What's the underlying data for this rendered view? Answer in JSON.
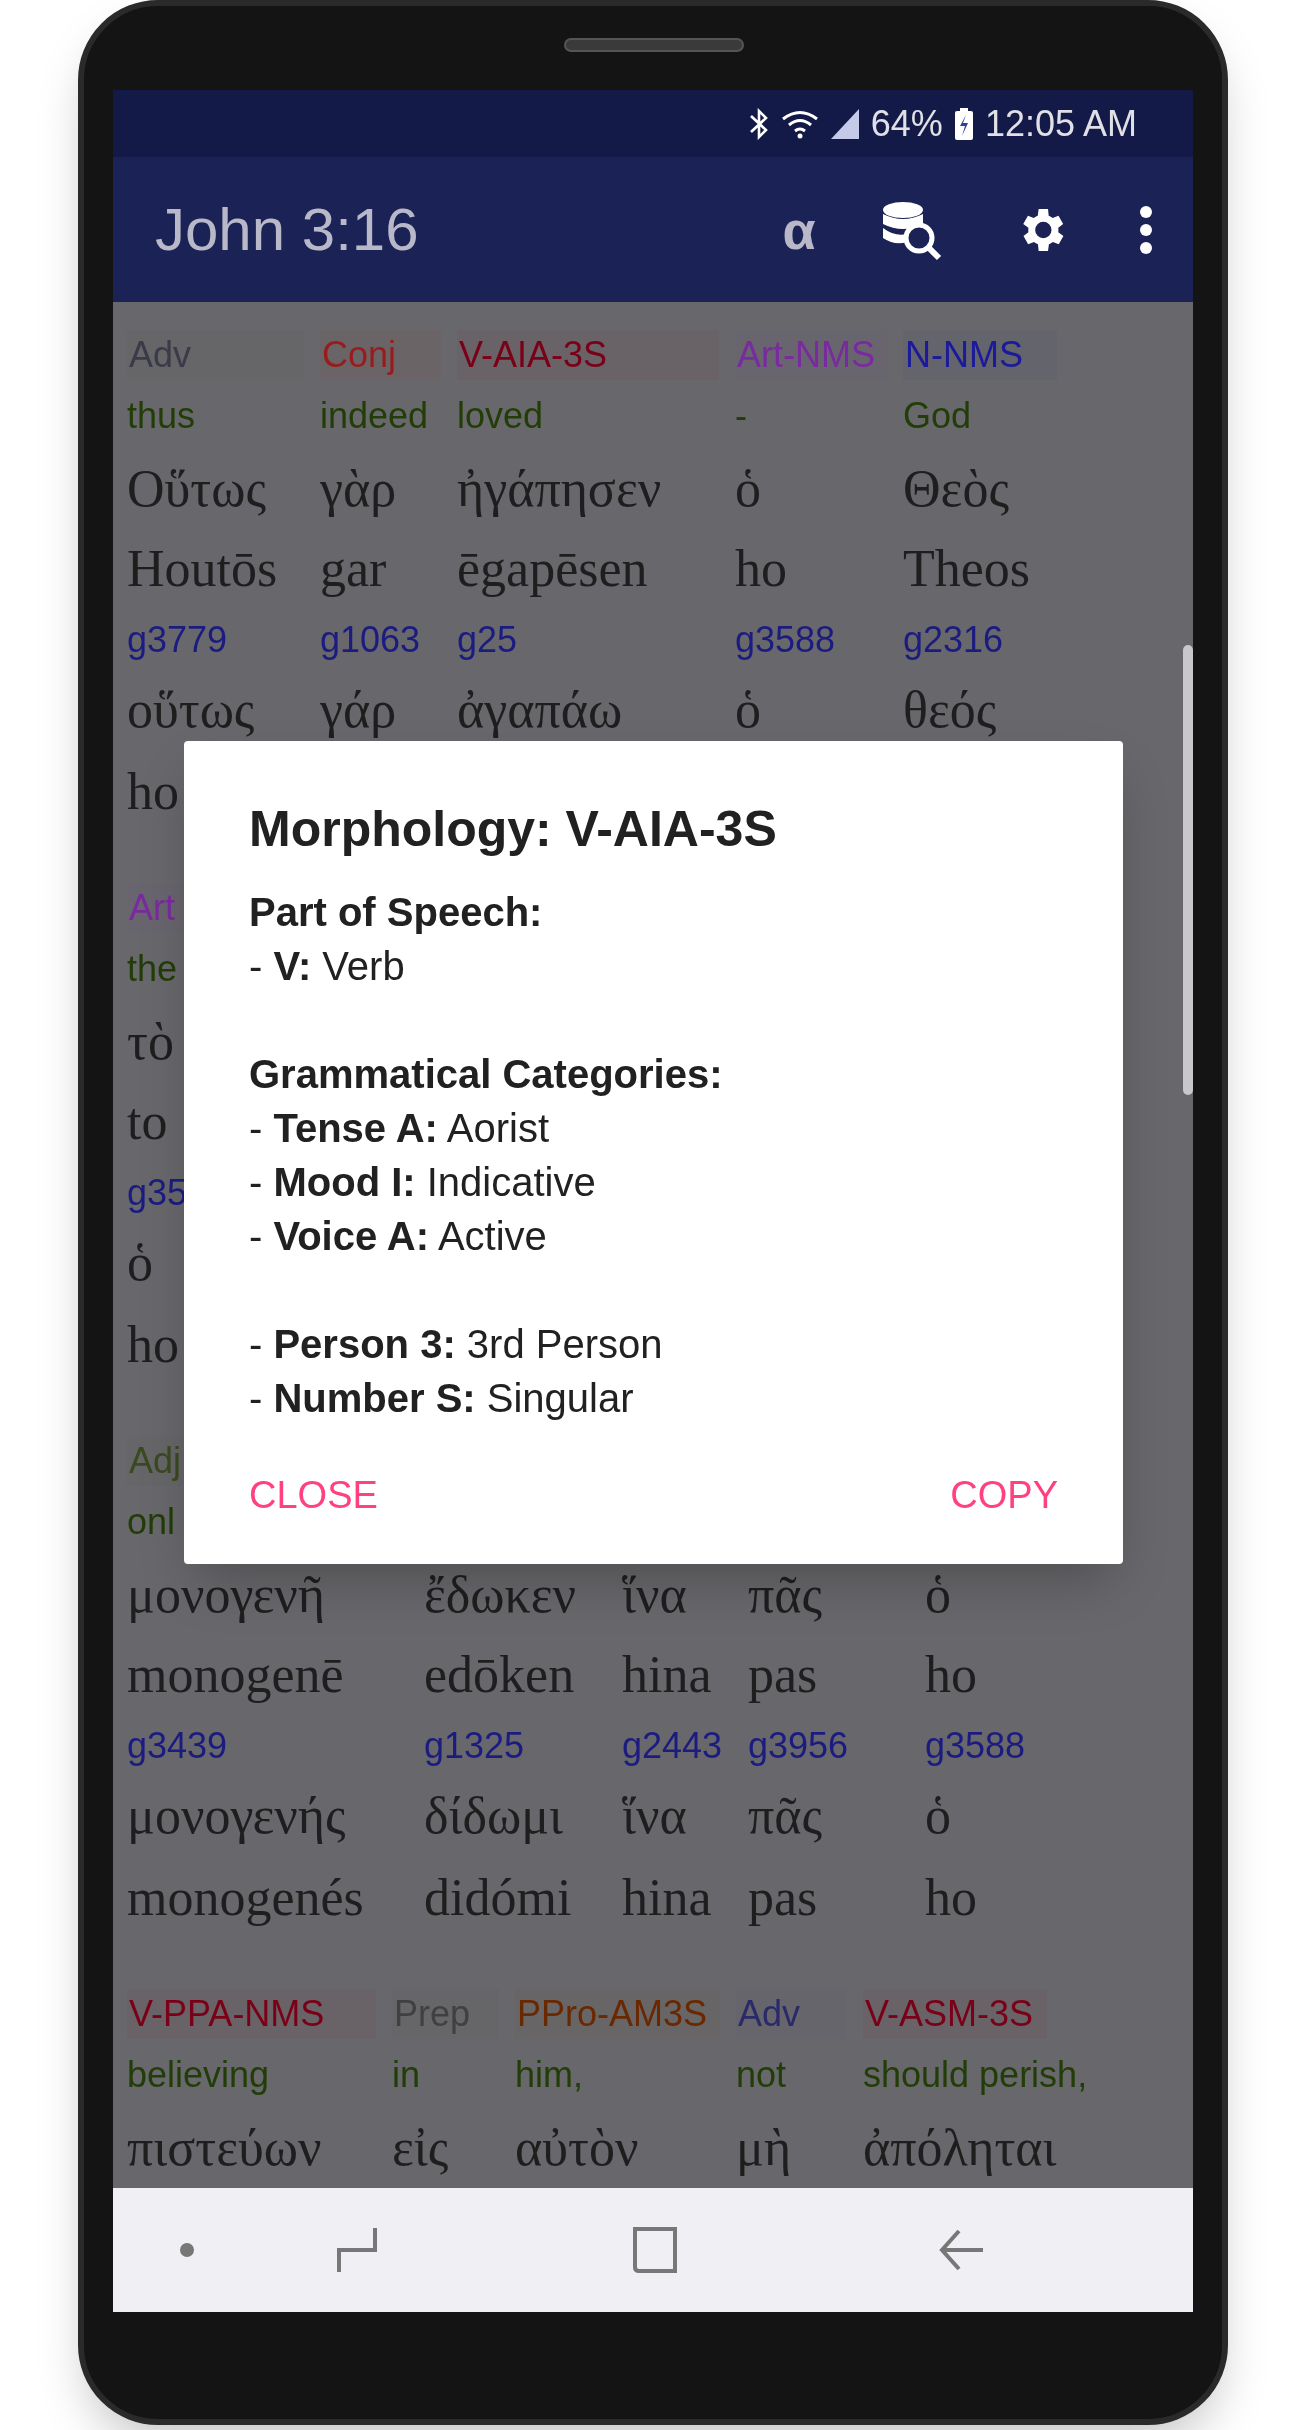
{
  "status_bar": {
    "battery_text": "64%",
    "time": "12:05 AM"
  },
  "app_bar": {
    "title": "John 3:16",
    "alpha_button": "α"
  },
  "blocks": [
    {
      "columns": [
        {
          "tag": "Adv",
          "color": "#3a3a48",
          "gloss": "thus",
          "greek": "Οὕτως",
          "translit": "Houtōs",
          "strong": "g3779",
          "lemma": "οὕτως",
          "lemma_translit": "ho"
        },
        {
          "tag": "Conj",
          "color": "#9a1b1b",
          "gloss": "indeed",
          "greek": "γὰρ",
          "translit": "gar",
          "strong": "g1063",
          "lemma": "γάρ"
        },
        {
          "tag": "V-AIA-3S",
          "color": "#7a0018",
          "gloss": "loved",
          "greek": "ἠγάπησεν",
          "translit": "ēgapēsen",
          "strong": "g25",
          "lemma": "ἀγαπάω"
        },
        {
          "tag": "Art-NMS",
          "color": "#7a2aa0",
          "gloss": "-",
          "greek": "ὁ",
          "translit": "ho",
          "strong": "g3588",
          "lemma": "ὁ"
        },
        {
          "tag": "N-NMS",
          "color": "#1a1a9a",
          "gloss": "God",
          "greek": "Θεὸς",
          "translit": "Theos",
          "strong": "g2316",
          "lemma": "θεός"
        }
      ]
    },
    {
      "columns": [
        {
          "tag": "Art",
          "color": "#7a2aa0",
          "gloss": "the",
          "greek": "τὸ",
          "translit": "to",
          "strong": "g35",
          "lemma": "ὁ",
          "lemma_translit": "ho"
        }
      ]
    },
    {
      "columns": [
        {
          "tag": "Adj",
          "color": "#3a4a20",
          "gloss": "onl",
          "greek": "μονογενῆ",
          "translit": "monogenē",
          "strong": "g3439",
          "lemma": "μονογενής",
          "lemma_translit": "monogenés"
        },
        {
          "greek": "ἔδωκεν",
          "translit": "edōken",
          "strong": "g1325",
          "lemma": "δίδωμι",
          "lemma_translit": "didómi"
        },
        {
          "greek": "ἵνα",
          "translit": "hina",
          "strong": "g2443",
          "lemma": "ἵνα",
          "lemma_translit": "hina"
        },
        {
          "greek": "πᾶς",
          "translit": "pas",
          "strong": "g3956",
          "lemma": "πᾶς",
          "lemma_translit": "pas"
        },
        {
          "greek": "ὁ",
          "translit": "ho",
          "strong": "g3588",
          "lemma": "ὁ",
          "lemma_translit": "ho"
        }
      ]
    },
    {
      "columns": [
        {
          "tag": "V-PPA-NMS",
          "color": "#7a0018",
          "gloss": "believing",
          "greek": "πιστεύων"
        },
        {
          "tag": "Prep",
          "color": "#404040",
          "gloss": "in",
          "greek": "εἰς"
        },
        {
          "tag": "PPro-AM3S",
          "color": "#6a2800",
          "gloss": "him,",
          "greek": "αὐτὸν"
        },
        {
          "tag": "Adv",
          "color": "#2a2a6a",
          "gloss": "not",
          "greek": "μὴ"
        },
        {
          "tag": "V-ASM-3S",
          "color": "#7a0018",
          "gloss": "should perish,",
          "greek": "ἀπόληται"
        }
      ]
    }
  ],
  "dialog": {
    "title": "Morphology: V-AIA-3S",
    "groups": [
      {
        "heading": "Part of Speech:",
        "lines": [
          "- **V:** Verb"
        ]
      },
      {
        "heading": "Grammatical Categories:",
        "lines": [
          "- **Tense A:** Aorist",
          "- **Mood I:** Indicative",
          "- **Voice A:** Active"
        ]
      },
      {
        "lines": [
          "- **Person 3:** 3rd Person",
          "- **Number S:** Singular"
        ]
      }
    ],
    "buttons": [
      "CLOSE",
      "COPY"
    ]
  }
}
